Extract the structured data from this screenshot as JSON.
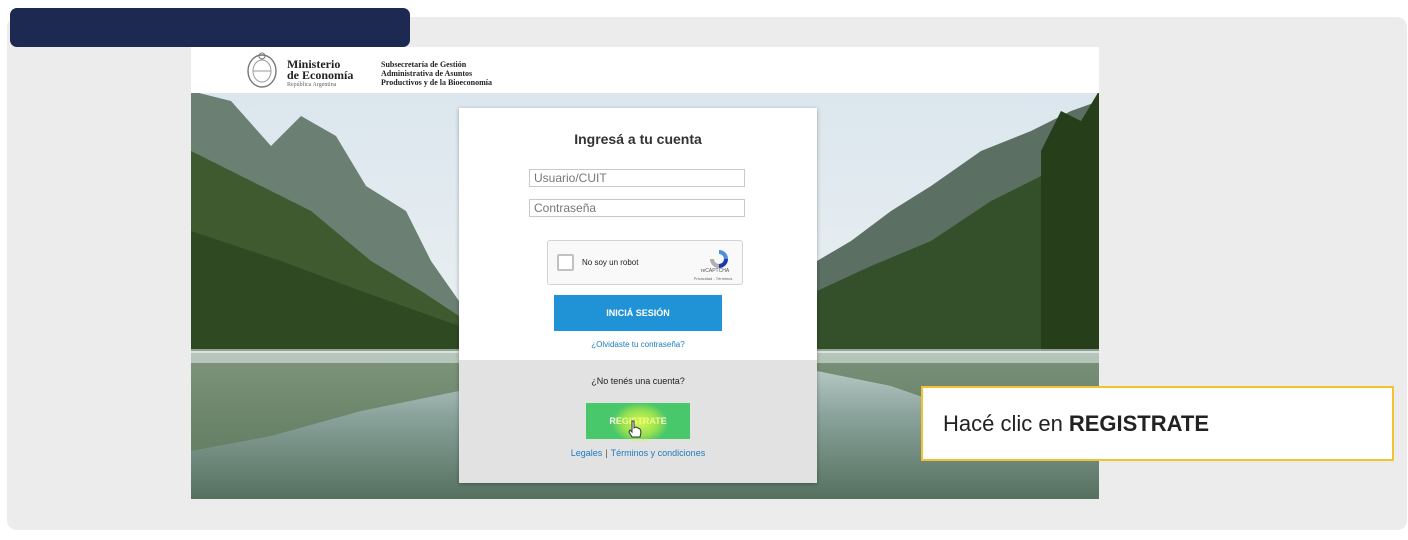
{
  "header": {
    "ministry_line1": "Ministerio",
    "ministry_line2": "de Economía",
    "ministry_country": "República Argentina",
    "subsecretaria_line1": "Subsecretaría de Gestión",
    "subsecretaria_line2": "Administrativa de Asuntos",
    "subsecretaria_line3": "Productivos y de la Bioeconomía"
  },
  "login": {
    "title": "Ingresá a tu cuenta",
    "username_placeholder": "Usuario/CUIT",
    "password_placeholder": "Contraseña",
    "captcha_label": "No soy un robot",
    "captcha_brand": "reCAPTCHA",
    "captcha_links": "Privacidad - Términos",
    "login_button": "INICIÁ SESIÓN",
    "forgot_link": "¿Olvidaste tu contraseña?",
    "no_account": "¿No tenés una cuenta?",
    "register_button": "REGISTRATE",
    "legal_link": "Legales",
    "separator": "|",
    "terms_link": "Términos y condiciones"
  },
  "callout": {
    "prefix": "Hacé clic en",
    "emphasis": "REGISTRATE"
  },
  "colors": {
    "top_bar": "#1e2952",
    "login_button": "#1f93d6",
    "register_button": "#48c86a",
    "link": "#1a7cc1",
    "callout_border": "#f2c230"
  }
}
